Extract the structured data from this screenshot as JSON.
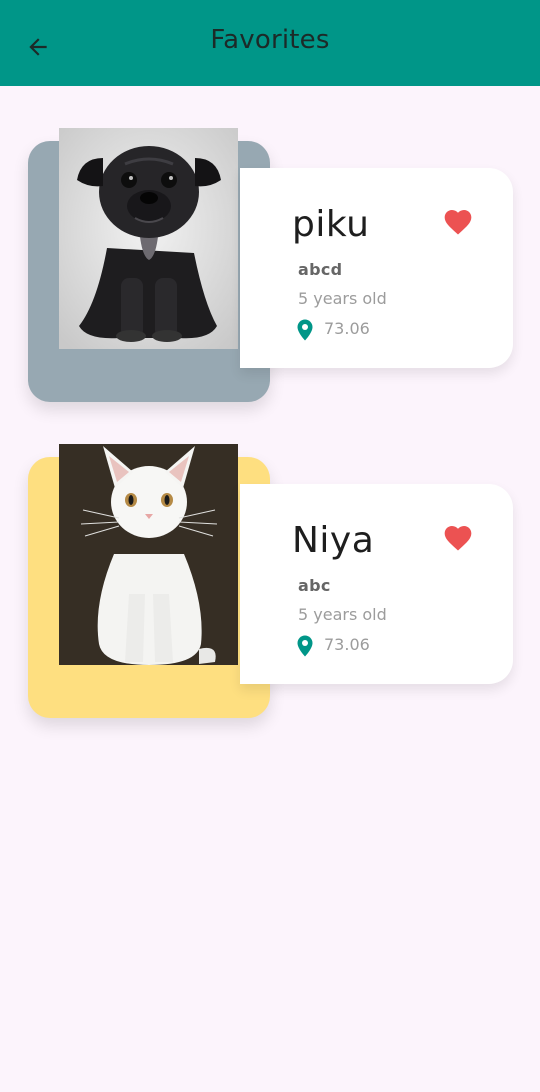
{
  "app_bar": {
    "title": "Favorites",
    "back_icon": "arrow-back-icon",
    "color": "#009688"
  },
  "favorites": [
    {
      "name": "piku",
      "breed": "abcd",
      "age": "5 years old",
      "distance": "73.06",
      "card_color": "#97a8b2",
      "photo": "black pug puppy",
      "favorite": true
    },
    {
      "name": "Niya",
      "breed": "abc",
      "age": "5 years old",
      "distance": "73.06",
      "card_color": "#fedf80",
      "photo": "white cat",
      "favorite": true
    }
  ],
  "colors": {
    "heart": "#ec5252",
    "location": "#009688",
    "background": "#fcf4fc"
  }
}
